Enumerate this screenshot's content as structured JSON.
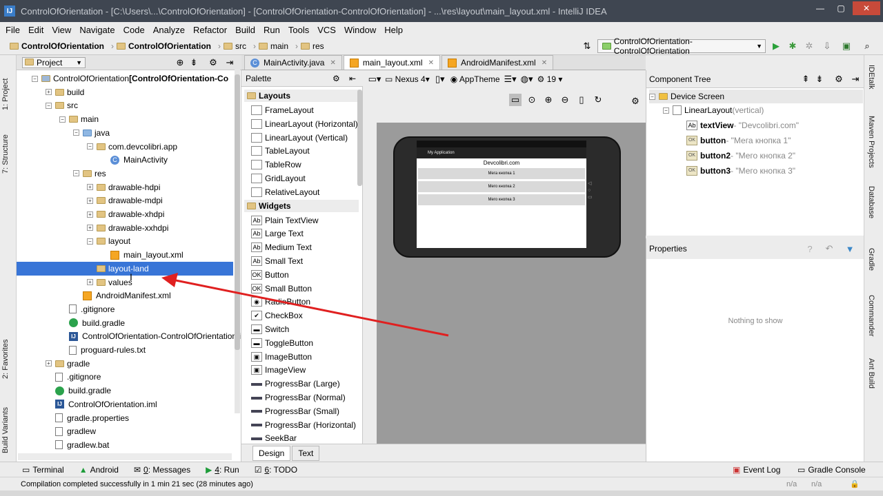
{
  "title_bar": {
    "text": "ControlOfOrientation - [C:\\Users\\...\\ControlOfOrientation] - [ControlOfOrientation-ControlOfOrientation] - ...\\res\\layout\\main_layout.xml - IntelliJ IDEA",
    "min": "—",
    "max": "▢",
    "close": "✕"
  },
  "menu": [
    "File",
    "Edit",
    "View",
    "Navigate",
    "Code",
    "Analyze",
    "Refactor",
    "Build",
    "Run",
    "Tools",
    "VCS",
    "Window",
    "Help"
  ],
  "breadcrumb": [
    "ControlOfOrientation",
    "ControlOfOrientation",
    "src",
    "main",
    "res"
  ],
  "run_config": "ControlOfOrientation-ControlOfOrientation",
  "left_tabs": {
    "project": "1: Project",
    "structure": "7: Structure",
    "favorites": "2: Favorites",
    "build_variants": "Build Variants"
  },
  "right_tabs": [
    "IDEtalk",
    "Maven Projects",
    "Database",
    "Gradle",
    "Commander",
    "Ant Build"
  ],
  "project_panel": {
    "mode": "Project",
    "tree": [
      {
        "label": "ControlOfOrientation",
        "suffix": " [ControlOfOrientation-Co",
        "type": "module"
      },
      {
        "label": "build",
        "type": "folder"
      },
      {
        "label": "src",
        "type": "folder"
      },
      {
        "label": "main",
        "type": "folder"
      },
      {
        "label": "java",
        "type": "folder-blue"
      },
      {
        "label": "com.devcolibri.app",
        "type": "package"
      },
      {
        "label": "MainActivity",
        "type": "class"
      },
      {
        "label": "res",
        "type": "folder"
      },
      {
        "label": "drawable-hdpi",
        "type": "package"
      },
      {
        "label": "drawable-mdpi",
        "type": "package"
      },
      {
        "label": "drawable-xhdpi",
        "type": "package"
      },
      {
        "label": "drawable-xxhdpi",
        "type": "package"
      },
      {
        "label": "layout",
        "type": "package"
      },
      {
        "label": "main_layout.xml",
        "type": "xml"
      },
      {
        "label": "layout-land",
        "type": "package",
        "selected": true
      },
      {
        "label": "values",
        "type": "package"
      },
      {
        "label": "AndroidManifest.xml",
        "type": "xml"
      },
      {
        "label": ".gitignore",
        "type": "file"
      },
      {
        "label": "build.gradle",
        "type": "gradle"
      },
      {
        "label": "ControlOfOrientation-ControlOfOrientation.i",
        "type": "iml"
      },
      {
        "label": "proguard-rules.txt",
        "type": "file"
      },
      {
        "label": "gradle",
        "type": "folder"
      },
      {
        "label": ".gitignore",
        "type": "file"
      },
      {
        "label": "build.gradle",
        "type": "gradle"
      },
      {
        "label": "ControlOfOrientation.iml",
        "type": "iml"
      },
      {
        "label": "gradle.properties",
        "type": "file"
      },
      {
        "label": "gradlew",
        "type": "file"
      },
      {
        "label": "gradlew.bat",
        "type": "file"
      }
    ]
  },
  "editor_tabs": [
    {
      "label": "MainActivity.java",
      "active": false
    },
    {
      "label": "main_layout.xml",
      "active": true
    },
    {
      "label": "AndroidManifest.xml",
      "active": false
    }
  ],
  "palette": {
    "title": "Palette",
    "layouts_title": "Layouts",
    "layouts": [
      "FrameLayout",
      "LinearLayout (Horizontal)",
      "LinearLayout (Vertical)",
      "TableLayout",
      "TableRow",
      "GridLayout",
      "RelativeLayout"
    ],
    "widgets_title": "Widgets",
    "widgets": [
      {
        "label": "Plain TextView",
        "icon": "Ab"
      },
      {
        "label": "Large Text",
        "icon": "Ab"
      },
      {
        "label": "Medium Text",
        "icon": "Ab"
      },
      {
        "label": "Small Text",
        "icon": "Ab"
      },
      {
        "label": "Button",
        "icon": "OK"
      },
      {
        "label": "Small Button",
        "icon": "OK"
      },
      {
        "label": "RadioButton",
        "icon": "◉"
      },
      {
        "label": "CheckBox",
        "icon": "✔"
      },
      {
        "label": "Switch",
        "icon": "▬"
      },
      {
        "label": "ToggleButton",
        "icon": "▬"
      },
      {
        "label": "ImageButton",
        "icon": "▣"
      },
      {
        "label": "ImageView",
        "icon": "▣"
      },
      {
        "label": "ProgressBar (Large)",
        "icon": "pb"
      },
      {
        "label": "ProgressBar (Normal)",
        "icon": "pb"
      },
      {
        "label": "ProgressBar (Small)",
        "icon": "pb"
      },
      {
        "label": "ProgressBar (Horizontal)",
        "icon": "pb"
      },
      {
        "label": "SeekBar",
        "icon": "pb"
      }
    ]
  },
  "design_toolbar": {
    "device": "Nexus 4",
    "theme": "AppTheme",
    "api": "19"
  },
  "preview": {
    "app_title": "My Application",
    "text_view": "Devcolibri.com",
    "buttons": [
      "Мега кнопка 1",
      "Мего кнопка 2",
      "Мего кнопка 3"
    ]
  },
  "bottom_tabs": [
    "Design",
    "Text"
  ],
  "component_tree": {
    "title": "Component Tree",
    "items": [
      {
        "name": "Device Screen",
        "detail": ""
      },
      {
        "name": "LinearLayout",
        "detail": " (vertical)"
      },
      {
        "name": "textView",
        "detail": " - \"Devcolibri.com\""
      },
      {
        "name": "button",
        "detail": " - \"Мега кнопка 1\""
      },
      {
        "name": "button2",
        "detail": " - \"Мего кнопка 2\""
      },
      {
        "name": "button3",
        "detail": " - \"Мего кнопка 3\""
      }
    ]
  },
  "properties": {
    "title": "Properties",
    "empty": "Nothing to show"
  },
  "tool_windows": {
    "left": [
      {
        "key": "",
        "label": "Terminal"
      },
      {
        "key": "",
        "label": "Android"
      },
      {
        "key": "0",
        "label": ": Messages"
      },
      {
        "key": "4",
        "label": ": Run"
      },
      {
        "key": "6",
        "label": ": TODO"
      }
    ],
    "right": [
      "Event Log",
      "Gradle Console"
    ]
  },
  "status": {
    "message": "Compilation completed successfully in 1 min 21 sec (28 minutes ago)",
    "na1": "n/a",
    "na2": "n/a"
  },
  "colors": {
    "selection": "#3875d7",
    "arrow": "#e02020",
    "titlebar": "#3f4651"
  }
}
